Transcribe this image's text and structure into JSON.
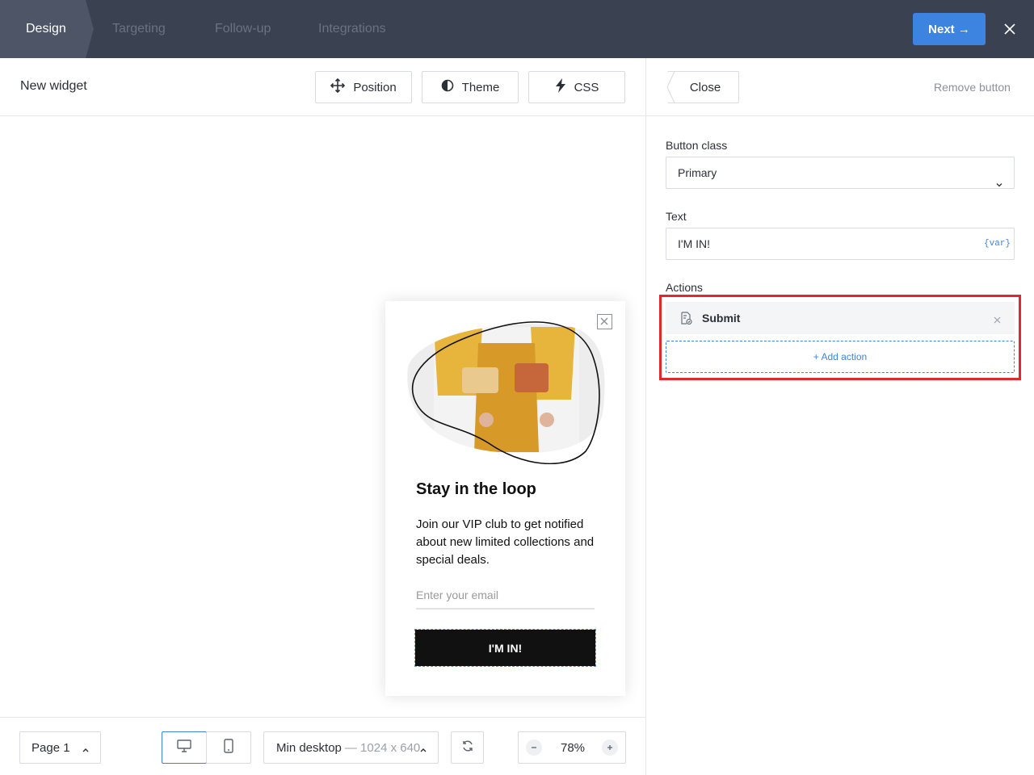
{
  "nav": {
    "steps": [
      "Design",
      "Targeting",
      "Follow-up",
      "Integrations"
    ],
    "next_label": "Next →"
  },
  "toolbar": {
    "widget_title": "New widget",
    "position_label": "Position",
    "theme_label": "Theme",
    "css_label": "CSS"
  },
  "popup": {
    "title": "Stay in the loop",
    "body": "Join our VIP club to get notified about new limited collections and special deals.",
    "email_placeholder": "Enter your email",
    "cta_label": "I'M IN!"
  },
  "bottom": {
    "page_label": "Page 1",
    "resolution_label": "Min desktop",
    "resolution_sub": "— 1024 x 640",
    "zoom": "78%"
  },
  "panel": {
    "close_label": "Close",
    "remove_label": "Remove button",
    "button_class_label": "Button class",
    "button_class_value": "Primary",
    "text_label": "Text",
    "text_value": "I'M IN!",
    "var_tag": "{var}",
    "actions_label": "Actions",
    "actions": [
      {
        "name": "Submit",
        "icon": "form-submit-icon"
      }
    ],
    "add_action_label": "+ Add action"
  },
  "colors": {
    "topbar": "#3a4150",
    "accent": "#3d84e0",
    "highlight": "#e0282e",
    "cta": "#111111"
  }
}
